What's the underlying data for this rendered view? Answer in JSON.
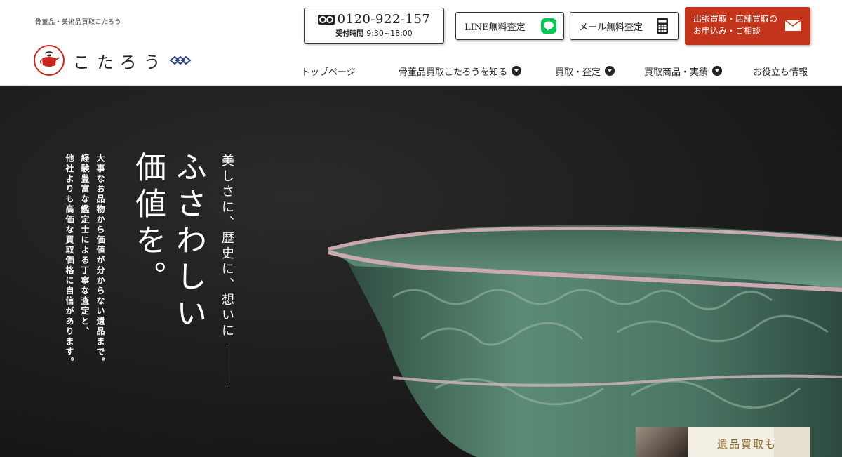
{
  "header": {
    "tagline": "骨董品・美術品買取こたろう",
    "logo_text": "こたろう",
    "phone": {
      "number": "0120-922-157",
      "hours_label": "受付時間",
      "hours": "9:30~18:00"
    },
    "line_button": "LINE無料査定",
    "mail_button": "メール無料査定",
    "cta": {
      "line1": "出張買取・店舗買取の",
      "line2": "お申込み・ご相談"
    },
    "nav": [
      {
        "label": "トップページ"
      },
      {
        "label": "骨董品買取こたろうを知る"
      },
      {
        "label": "買取・査定"
      },
      {
        "label": "買取商品・実績"
      },
      {
        "label": "お役立ち情報"
      }
    ]
  },
  "hero": {
    "sub": "美しさに、歴史に、想いに",
    "main_line1": "ふさわしい",
    "main_line2": "価値を。",
    "body_lines": [
      "大事なお品物から価値が分からない遺品まで。",
      "経験豊富な鑑定士による丁寧な査定と、",
      "他社よりも高価な買取価格に自信があります。"
    ],
    "promo": "遺品買取も"
  },
  "colors": {
    "accent": "#c4341a",
    "hero_bg": "#1b1b1b",
    "celadon": "#4e7a66"
  }
}
